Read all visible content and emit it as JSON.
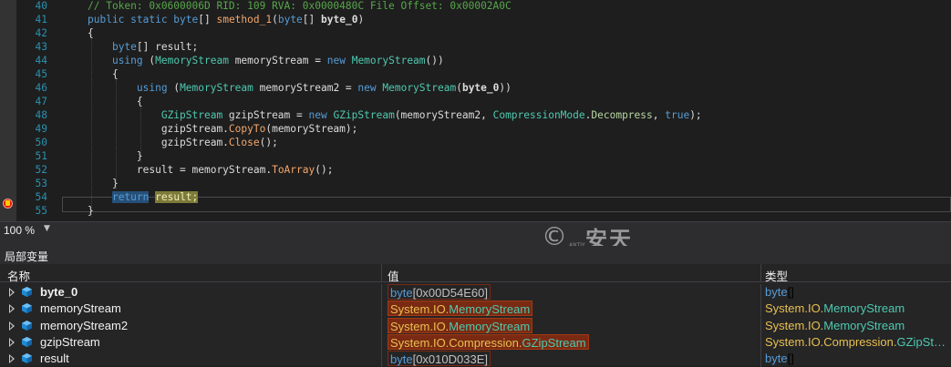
{
  "editor": {
    "lines": [
      {
        "num": "40",
        "parts": [
          {
            "t": "// Token: 0x0600006D RID: 109 RVA: 0x0000480C File Offset: 0x00002A0C",
            "c": "cm"
          }
        ]
      },
      {
        "num": "41",
        "parts": [
          {
            "t": "public static ",
            "c": "kw"
          },
          {
            "t": "byte",
            "c": "kw"
          },
          {
            "t": "[] ",
            "c": ""
          },
          {
            "t": "smethod_1",
            "c": "mt"
          },
          {
            "t": "(",
            "c": ""
          },
          {
            "t": "byte",
            "c": "kw"
          },
          {
            "t": "[] ",
            "c": ""
          },
          {
            "t": "byte_0",
            "c": "bold"
          },
          {
            "t": ")",
            "c": ""
          }
        ]
      },
      {
        "num": "42",
        "parts": [
          {
            "t": "{",
            "c": ""
          }
        ]
      },
      {
        "num": "43",
        "parts": [
          {
            "t": "    ",
            "c": ""
          },
          {
            "t": "byte",
            "c": "kw"
          },
          {
            "t": "[] result;",
            "c": ""
          }
        ]
      },
      {
        "num": "44",
        "parts": [
          {
            "t": "    ",
            "c": ""
          },
          {
            "t": "using",
            "c": "kw"
          },
          {
            "t": " (",
            "c": ""
          },
          {
            "t": "MemoryStream",
            "c": "ty"
          },
          {
            "t": " memoryStream = ",
            "c": ""
          },
          {
            "t": "new",
            "c": "kw"
          },
          {
            "t": " ",
            "c": ""
          },
          {
            "t": "MemoryStream",
            "c": "ty"
          },
          {
            "t": "())",
            "c": ""
          }
        ]
      },
      {
        "num": "45",
        "parts": [
          {
            "t": "    {",
            "c": ""
          }
        ]
      },
      {
        "num": "46",
        "parts": [
          {
            "t": "        ",
            "c": ""
          },
          {
            "t": "using",
            "c": "kw"
          },
          {
            "t": " (",
            "c": ""
          },
          {
            "t": "MemoryStream",
            "c": "ty"
          },
          {
            "t": " memoryStream2 = ",
            "c": ""
          },
          {
            "t": "new",
            "c": "kw"
          },
          {
            "t": " ",
            "c": ""
          },
          {
            "t": "MemoryStream",
            "c": "ty"
          },
          {
            "t": "(",
            "c": ""
          },
          {
            "t": "byte_0",
            "c": "bold"
          },
          {
            "t": "))",
            "c": ""
          }
        ]
      },
      {
        "num": "47",
        "parts": [
          {
            "t": "        {",
            "c": ""
          }
        ]
      },
      {
        "num": "48",
        "parts": [
          {
            "t": "            ",
            "c": ""
          },
          {
            "t": "GZipStream",
            "c": "ty"
          },
          {
            "t": " gzipStream = ",
            "c": ""
          },
          {
            "t": "new",
            "c": "kw"
          },
          {
            "t": " ",
            "c": ""
          },
          {
            "t": "GZipStream",
            "c": "ty"
          },
          {
            "t": "(memoryStream2, ",
            "c": ""
          },
          {
            "t": "CompressionMode",
            "c": "ty"
          },
          {
            "t": ".",
            "c": ""
          },
          {
            "t": "Decompress",
            "c": "en"
          },
          {
            "t": ", ",
            "c": ""
          },
          {
            "t": "true",
            "c": "kw"
          },
          {
            "t": ");",
            "c": ""
          }
        ]
      },
      {
        "num": "49",
        "parts": [
          {
            "t": "            gzipStream.",
            "c": ""
          },
          {
            "t": "CopyTo",
            "c": "mt"
          },
          {
            "t": "(memoryStream);",
            "c": ""
          }
        ]
      },
      {
        "num": "50",
        "parts": [
          {
            "t": "            gzipStream.",
            "c": ""
          },
          {
            "t": "Close",
            "c": "mt"
          },
          {
            "t": "();",
            "c": ""
          }
        ]
      },
      {
        "num": "51",
        "parts": [
          {
            "t": "        }",
            "c": ""
          }
        ]
      },
      {
        "num": "52",
        "parts": [
          {
            "t": "        result = memoryStream.",
            "c": ""
          },
          {
            "t": "ToArray",
            "c": "mt"
          },
          {
            "t": "();",
            "c": ""
          }
        ]
      },
      {
        "num": "53",
        "parts": [
          {
            "t": "    }",
            "c": ""
          }
        ]
      },
      {
        "num": "54",
        "parts": [
          {
            "t": "    ",
            "c": ""
          },
          {
            "t": "return",
            "c": "kw hl-return"
          },
          {
            "t": " ",
            "c": ""
          },
          {
            "t": "result;",
            "c": "hl-result"
          }
        ]
      },
      {
        "num": "55",
        "parts": [
          {
            "t": "}",
            "c": ""
          }
        ]
      }
    ]
  },
  "zoom": {
    "level": "100 %",
    "dropdown_icon": "chevron-down-icon"
  },
  "watermark": {
    "symbol": "©",
    "brand_small": "ANTIY",
    "brand_cn": "安天"
  },
  "locals": {
    "title": "局部变量",
    "col_name": "名称",
    "col_value": "值",
    "col_type": "类型",
    "rows": [
      {
        "name": "byte_0",
        "bold": true,
        "value": [
          {
            "t": "byte",
            "c": "blue"
          },
          {
            "t": "[0x00D54E60]",
            "c": ""
          }
        ],
        "vstyle": "arr",
        "type": [
          {
            "t": "byte",
            "c": "blue"
          },
          {
            "t": "[]",
            "c": ""
          }
        ]
      },
      {
        "name": "memoryStream",
        "bold": false,
        "value": [
          {
            "t": "System.IO.",
            "c": "y"
          },
          {
            "t": "MemoryStream",
            "c": "cls"
          }
        ],
        "vstyle": "obj",
        "type": [
          {
            "t": "System.IO.",
            "c": "y"
          },
          {
            "t": "MemoryStream",
            "c": "cls"
          }
        ]
      },
      {
        "name": "memoryStream2",
        "bold": false,
        "value": [
          {
            "t": "System.IO.",
            "c": "y"
          },
          {
            "t": "MemoryStream",
            "c": "cls"
          }
        ],
        "vstyle": "obj",
        "type": [
          {
            "t": "System.IO.",
            "c": "y"
          },
          {
            "t": "MemoryStream",
            "c": "cls"
          }
        ]
      },
      {
        "name": "gzipStream",
        "bold": false,
        "value": [
          {
            "t": "System.IO.Compression.",
            "c": "y"
          },
          {
            "t": "GZipStream",
            "c": "cls"
          }
        ],
        "vstyle": "obj",
        "type": [
          {
            "t": "System.IO.Compression.",
            "c": "y"
          },
          {
            "t": "GZipSt…",
            "c": "cls"
          }
        ]
      },
      {
        "name": "result",
        "bold": false,
        "value": [
          {
            "t": "byte",
            "c": "blue"
          },
          {
            "t": "[0x010D033E]",
            "c": ""
          }
        ],
        "vstyle": "arr",
        "type": [
          {
            "t": "byte",
            "c": "blue"
          },
          {
            "t": "[]",
            "c": ""
          }
        ]
      }
    ]
  },
  "colors": {
    "background": "#1e1e1e",
    "keyword": "#569cd6",
    "type": "#4ec9b0",
    "comment": "#57a64a",
    "method": "#f5a76c",
    "breakpoint": "#e51400"
  }
}
